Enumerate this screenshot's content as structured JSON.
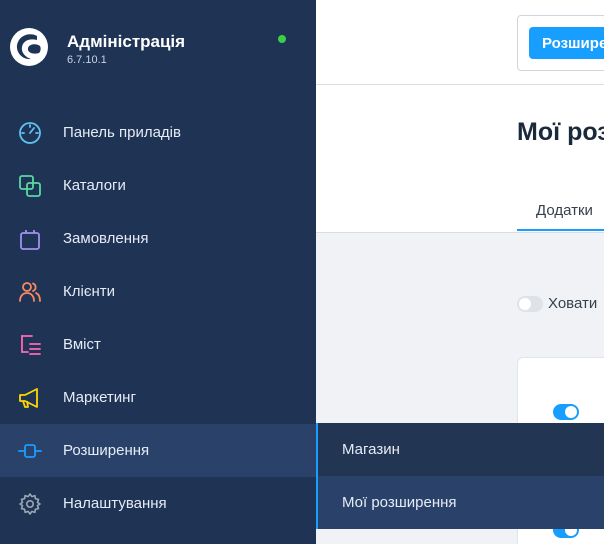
{
  "brand": {
    "title": "Адміністрація",
    "version": "6.7.10.1",
    "status_color": "#37d046"
  },
  "sidebar": {
    "items": [
      {
        "label": "Панель приладів",
        "icon": "gauge-icon",
        "color": "#5fc3f0"
      },
      {
        "label": "Каталоги",
        "icon": "catalog-icon",
        "color": "#57d9a3"
      },
      {
        "label": "Замовлення",
        "icon": "shopping-bag-icon",
        "color": "#a092f0"
      },
      {
        "label": "Клієнти",
        "icon": "users-icon",
        "color": "#f88962"
      },
      {
        "label": "Вміст",
        "icon": "content-icon",
        "color": "#ff68b4"
      },
      {
        "label": "Маркетинг",
        "icon": "megaphone-icon",
        "color": "#ffd700"
      },
      {
        "label": "Розширення",
        "icon": "plug-icon",
        "color": "#189eff"
      },
      {
        "label": "Налаштування",
        "icon": "gear-icon",
        "color": "#9aa8b5"
      }
    ],
    "active_index": 6
  },
  "flyout": {
    "items": [
      {
        "label": "Магазин"
      },
      {
        "label": "Мої розширення"
      }
    ]
  },
  "content": {
    "top_button_label": "Розширення",
    "page_title": "Мої розширення",
    "tab_label": "Додатки",
    "hide_toggle_label": "Ховати",
    "accent": "#189eff"
  }
}
